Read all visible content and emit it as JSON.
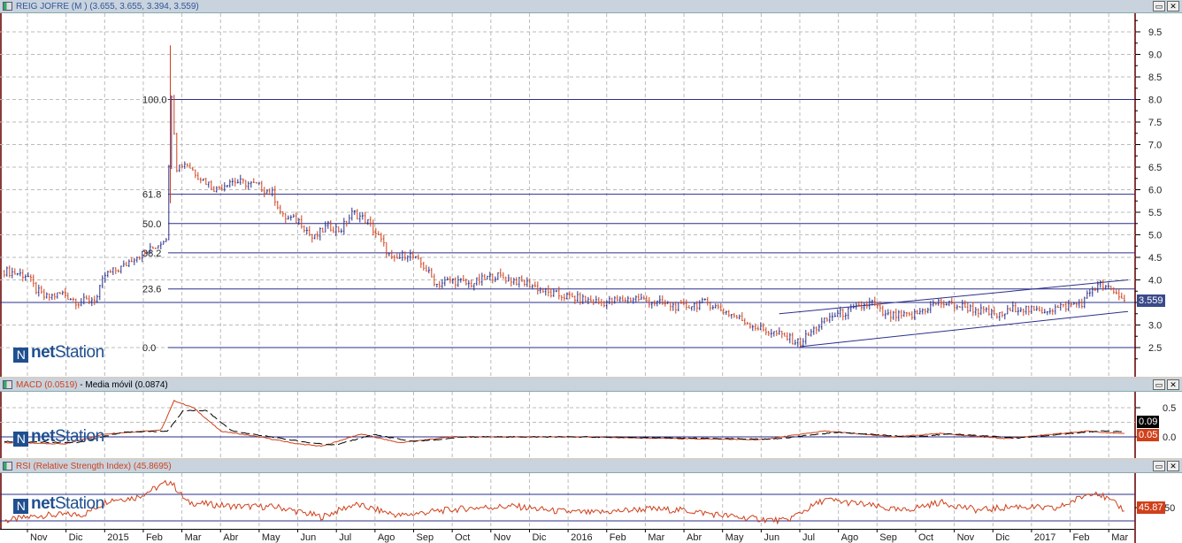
{
  "main_panel": {
    "title": "REIG JOFRE (M ) (3.655, 3.655, 3.394, 3.559)",
    "last_price_tag": "3.559",
    "price_tag_color": "#3a4a8a"
  },
  "macd_panel": {
    "title_macd": "MACD (0.0519)",
    "separator": " - ",
    "title_signal": "Media móvil (0.0874)",
    "macd_tag": "0.05",
    "signal_tag": "0.09",
    "macd_color": "#d0401a",
    "signal_color": "#000000"
  },
  "rsi_panel": {
    "title": "RSI (Relative Strength Index) (45.8695)",
    "rsi_tag": "45.87",
    "rsi_color": "#d0401a"
  },
  "logo": {
    "text_bold": "net",
    "text": "Station"
  },
  "window_buttons": {
    "restore": "▭",
    "close": "✕"
  },
  "chart_data": [
    {
      "type": "ohlc",
      "title": "REIG JOFRE (M )",
      "ylim": [
        2.1,
        9.9
      ],
      "yticks": [
        2.5,
        3.0,
        3.5,
        4.0,
        4.5,
        5.0,
        5.5,
        6.0,
        6.5,
        7.0,
        7.5,
        8.0,
        8.5,
        9.0,
        9.5
      ],
      "ytick_labels": [
        "2.5",
        "3.0",
        "3.5",
        "4.0",
        "4.5",
        "5.0",
        "5.5",
        "6.0",
        "6.5",
        "7.0",
        "7.5",
        "8.0",
        "8.5",
        "9.0",
        "9.5"
      ],
      "grid": true,
      "spike": {
        "date": "2015-02-22",
        "high": 9.2,
        "low": 5.7
      },
      "close_series": [
        [
          "2014-10-13",
          4.2
        ],
        [
          "2014-10-31",
          4.1
        ],
        [
          "2014-11-07",
          3.8
        ],
        [
          "2014-11-15",
          3.6
        ],
        [
          "2014-11-28",
          3.7
        ],
        [
          "2014-12-11",
          3.5
        ],
        [
          "2014-12-25",
          3.6
        ],
        [
          "2015-01-01",
          4.1
        ],
        [
          "2015-01-16",
          4.3
        ],
        [
          "2015-01-23",
          4.5
        ],
        [
          "2015-02-03",
          4.6
        ],
        [
          "2015-02-13",
          4.8
        ],
        [
          "2015-02-20",
          5.0
        ],
        [
          "2015-02-22",
          8.5
        ],
        [
          "2015-02-27",
          6.5
        ],
        [
          "2015-03-04",
          6.6
        ],
        [
          "2015-03-14",
          6.3
        ],
        [
          "2015-03-28",
          6.0
        ],
        [
          "2015-04-08",
          6.2
        ],
        [
          "2015-04-29",
          6.1
        ],
        [
          "2015-05-12",
          5.9
        ],
        [
          "2015-05-19",
          5.4
        ],
        [
          "2015-06-03",
          5.3
        ],
        [
          "2015-06-13",
          4.9
        ],
        [
          "2015-06-24",
          5.2
        ],
        [
          "2015-07-04",
          5.1
        ],
        [
          "2015-07-14",
          5.5
        ],
        [
          "2015-07-25",
          5.3
        ],
        [
          "2015-08-05",
          4.9
        ],
        [
          "2015-08-15",
          4.4
        ],
        [
          "2015-08-26",
          4.6
        ],
        [
          "2015-09-09",
          4.3
        ],
        [
          "2015-09-19",
          3.9
        ],
        [
          "2015-09-30",
          4.0
        ],
        [
          "2015-10-14",
          3.9
        ],
        [
          "2015-11-04",
          4.1
        ],
        [
          "2015-11-18",
          4.0
        ],
        [
          "2015-12-02",
          3.9
        ],
        [
          "2015-12-16",
          3.7
        ],
        [
          "2016-01-06",
          3.6
        ],
        [
          "2016-01-27",
          3.5
        ],
        [
          "2016-02-24",
          3.6
        ],
        [
          "2016-03-08",
          3.5
        ],
        [
          "2016-03-29",
          3.4
        ],
        [
          "2016-04-19",
          3.5
        ],
        [
          "2016-05-03",
          3.3
        ],
        [
          "2016-05-17",
          3.1
        ],
        [
          "2016-05-31",
          2.9
        ],
        [
          "2016-06-14",
          2.8
        ],
        [
          "2016-07-01",
          2.6
        ],
        [
          "2016-07-12",
          2.9
        ],
        [
          "2016-07-26",
          3.2
        ],
        [
          "2016-08-09",
          3.3
        ],
        [
          "2016-08-27",
          3.5
        ],
        [
          "2016-09-07",
          3.2
        ],
        [
          "2016-09-28",
          3.2
        ],
        [
          "2016-10-18",
          3.5
        ],
        [
          "2016-11-09",
          3.4
        ],
        [
          "2016-11-23",
          3.3
        ],
        [
          "2016-12-06",
          3.2
        ],
        [
          "2016-12-20",
          3.4
        ],
        [
          "2017-01-04",
          3.3
        ],
        [
          "2017-01-25",
          3.4
        ],
        [
          "2017-02-11",
          3.5
        ],
        [
          "2017-02-18",
          3.8
        ],
        [
          "2017-02-25",
          3.9
        ],
        [
          "2017-03-06",
          3.7
        ],
        [
          "2017-03-14",
          3.559
        ]
      ],
      "fibonacci": [
        {
          "label": "100.0",
          "value": 8.0
        },
        {
          "label": "61.8",
          "value": 5.9
        },
        {
          "label": "50.0",
          "value": 5.25
        },
        {
          "label": "38.2",
          "value": 4.6
        },
        {
          "label": "23.6",
          "value": 3.8
        },
        {
          "label": "0.0",
          "value": 2.5
        }
      ],
      "support_line": 3.5,
      "channel": [
        {
          "from": [
            "2016-06-15",
            3.25
          ],
          "to": [
            "2017-03-16",
            4.0
          ]
        },
        {
          "from": [
            "2016-07-01",
            2.52
          ],
          "to": [
            "2017-03-16",
            3.3
          ]
        }
      ],
      "line_color": "#2a2f8a",
      "up_color": "#2a2f8a",
      "down_color": "#d0401a"
    },
    {
      "type": "line",
      "title": "MACD",
      "ylim": [
        -0.25,
        0.75
      ],
      "yticks": [
        0.0,
        0.5
      ],
      "ytick_labels": [
        "0.0",
        "0.5"
      ],
      "zero_line": 0,
      "series": [
        {
          "name": "MACD (0.0519)",
          "values": [
            [
              "2014-10-13",
              -0.1
            ],
            [
              "2014-12-01",
              -0.12
            ],
            [
              "2015-01-01",
              0.05
            ],
            [
              "2015-02-15",
              0.12
            ],
            [
              "2015-02-25",
              0.62
            ],
            [
              "2015-03-10",
              0.5
            ],
            [
              "2015-04-01",
              0.1
            ],
            [
              "2015-05-01",
              0.0
            ],
            [
              "2015-06-01",
              -0.12
            ],
            [
              "2015-06-20",
              -0.16
            ],
            [
              "2015-07-20",
              0.05
            ],
            [
              "2015-08-20",
              -0.1
            ],
            [
              "2015-09-10",
              -0.05
            ],
            [
              "2015-10-01",
              0.0
            ],
            [
              "2016-01-01",
              0.0
            ],
            [
              "2016-06-01",
              -0.05
            ],
            [
              "2016-07-20",
              0.1
            ],
            [
              "2016-09-15",
              0.0
            ],
            [
              "2016-10-20",
              0.06
            ],
            [
              "2016-12-10",
              -0.03
            ],
            [
              "2017-02-15",
              0.1
            ],
            [
              "2017-03-14",
              0.05
            ]
          ]
        },
        {
          "name": "Media móvil (0.0874)",
          "values": [
            [
              "2014-10-13",
              -0.08
            ],
            [
              "2014-12-10",
              -0.1
            ],
            [
              "2015-01-15",
              0.08
            ],
            [
              "2015-02-20",
              0.1
            ],
            [
              "2015-03-02",
              0.45
            ],
            [
              "2015-03-20",
              0.45
            ],
            [
              "2015-04-10",
              0.1
            ],
            [
              "2015-05-10",
              0.0
            ],
            [
              "2015-06-10",
              -0.1
            ],
            [
              "2015-06-30",
              -0.14
            ],
            [
              "2015-07-30",
              0.04
            ],
            [
              "2015-08-30",
              -0.08
            ],
            [
              "2015-09-20",
              -0.05
            ],
            [
              "2015-10-10",
              0.0
            ],
            [
              "2016-01-10",
              0.0
            ],
            [
              "2016-06-10",
              -0.04
            ],
            [
              "2016-07-30",
              0.08
            ],
            [
              "2016-09-25",
              0.0
            ],
            [
              "2016-10-30",
              0.05
            ],
            [
              "2016-12-20",
              -0.02
            ],
            [
              "2017-02-25",
              0.1
            ],
            [
              "2017-03-14",
              0.09
            ]
          ]
        }
      ]
    },
    {
      "type": "line",
      "title": "RSI (Relative Strength Index)",
      "ylim": [
        20,
        100
      ],
      "yticks": [
        50
      ],
      "ytick_labels": [
        "50"
      ],
      "reference_lines": [
        30,
        70
      ],
      "series": [
        {
          "name": "RSI (Relative Strength Index) (45.8695)",
          "values": [
            [
              "2014-10-13",
              30
            ],
            [
              "2014-11-10",
              38
            ],
            [
              "2014-12-15",
              40
            ],
            [
              "2015-01-05",
              62
            ],
            [
              "2015-01-25",
              65
            ],
            [
              "2015-02-22",
              90
            ],
            [
              "2015-03-05",
              58
            ],
            [
              "2015-04-10",
              52
            ],
            [
              "2015-05-15",
              51
            ],
            [
              "2015-06-20",
              36
            ],
            [
              "2015-07-15",
              55
            ],
            [
              "2015-08-20",
              38
            ],
            [
              "2015-09-20",
              45
            ],
            [
              "2015-10-20",
              50
            ],
            [
              "2015-11-20",
              52
            ],
            [
              "2015-12-20",
              45
            ],
            [
              "2016-01-20",
              42
            ],
            [
              "2016-03-01",
              48
            ],
            [
              "2016-04-01",
              46
            ],
            [
              "2016-05-15",
              35
            ],
            [
              "2016-06-20",
              30
            ],
            [
              "2016-07-20",
              62
            ],
            [
              "2016-08-20",
              55
            ],
            [
              "2016-09-20",
              45
            ],
            [
              "2016-10-20",
              58
            ],
            [
              "2016-11-20",
              46
            ],
            [
              "2016-12-20",
              52
            ],
            [
              "2017-01-20",
              48
            ],
            [
              "2017-02-20",
              75
            ],
            [
              "2017-03-14",
              45.87
            ]
          ]
        }
      ]
    }
  ],
  "x_axis": {
    "labels": [
      "Nov",
      "Dic",
      "2015",
      "Feb",
      "Mar",
      "Abr",
      "May",
      "Jun",
      "Jul",
      "Ago",
      "Sep",
      "Oct",
      "Nov",
      "Dic",
      "2016",
      "Feb",
      "Mar",
      "Abr",
      "May",
      "Jun",
      "Jul",
      "Ago",
      "Sep",
      "Oct",
      "Nov",
      "Dic",
      "2017",
      "Feb",
      "Mar"
    ]
  }
}
